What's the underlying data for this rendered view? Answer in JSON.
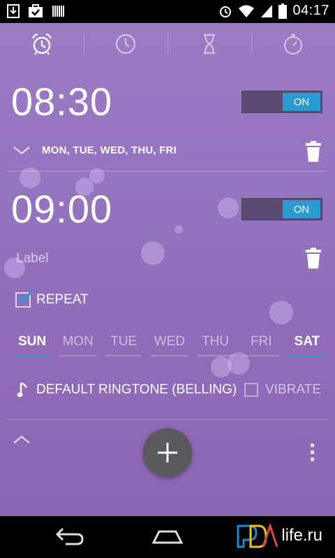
{
  "status_bar": {
    "time": "04:17"
  },
  "tabs": [
    {
      "icon": "alarm-clock-icon",
      "active": true
    },
    {
      "icon": "clock-icon",
      "active": false
    },
    {
      "icon": "hourglass-icon",
      "active": false
    },
    {
      "icon": "stopwatch-icon",
      "active": false
    }
  ],
  "alarms": [
    {
      "time": "08:30",
      "toggle": "ON",
      "days_summary": "MON, TUE, WED, THU, FRI"
    },
    {
      "time": "09:00",
      "toggle": "ON",
      "label": "Label",
      "repeat_label": "REPEAT",
      "repeat_checked": true,
      "days": [
        {
          "name": "SUN",
          "active": true
        },
        {
          "name": "MON",
          "active": false
        },
        {
          "name": "TUE",
          "active": false
        },
        {
          "name": "WED",
          "active": false
        },
        {
          "name": "THU",
          "active": false
        },
        {
          "name": "FRI",
          "active": false
        },
        {
          "name": "SAT",
          "active": true
        }
      ],
      "ringtone": "DEFAULT RINGTONE (BELLING)",
      "vibrate_label": "VIBRATE",
      "vibrate_checked": false
    }
  ],
  "watermark": {
    "text": "life.ru"
  },
  "colors": {
    "accent": "#2b9ad0",
    "background": "#9473bf",
    "fab": "#5a5a5e"
  }
}
